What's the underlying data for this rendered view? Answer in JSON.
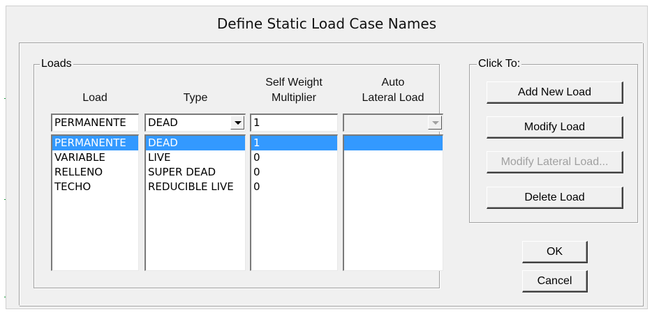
{
  "window": {
    "title": "Define Static Load Case Names"
  },
  "loads_group": {
    "legend": "Loads",
    "headers": {
      "load": "Load",
      "type": "Type",
      "self_weight_line1": "Self Weight",
      "self_weight_line2": "Multiplier",
      "auto_line1": "Auto",
      "auto_line2": "Lateral Load"
    },
    "inputs": {
      "load_name": "PERMANENTE",
      "type": "DEAD",
      "self_weight_multiplier": "1",
      "auto_lateral_load": ""
    },
    "rows": [
      {
        "load": "PERMANENTE",
        "type": "DEAD",
        "multiplier": "1",
        "selected": true
      },
      {
        "load": "VARIABLE",
        "type": "LIVE",
        "multiplier": "0",
        "selected": false
      },
      {
        "load": "RELLENO",
        "type": "SUPER DEAD",
        "multiplier": "0",
        "selected": false
      },
      {
        "load": "TECHO",
        "type": "REDUCIBLE LIVE",
        "multiplier": "0",
        "selected": false
      }
    ]
  },
  "click_to_group": {
    "legend": "Click To:",
    "add_new_load": "Add New Load",
    "modify_load": "Modify Load",
    "modify_lateral_load": "Modify Lateral Load...",
    "delete_load": "Delete Load"
  },
  "buttons": {
    "ok": "OK",
    "cancel": "Cancel"
  },
  "colors": {
    "selection": "#3399ff",
    "dialog_bg": "#f0f0f0",
    "disabled_text": "#a0a0a0"
  },
  "icons": {
    "dropdown": "chevron-down-icon"
  }
}
